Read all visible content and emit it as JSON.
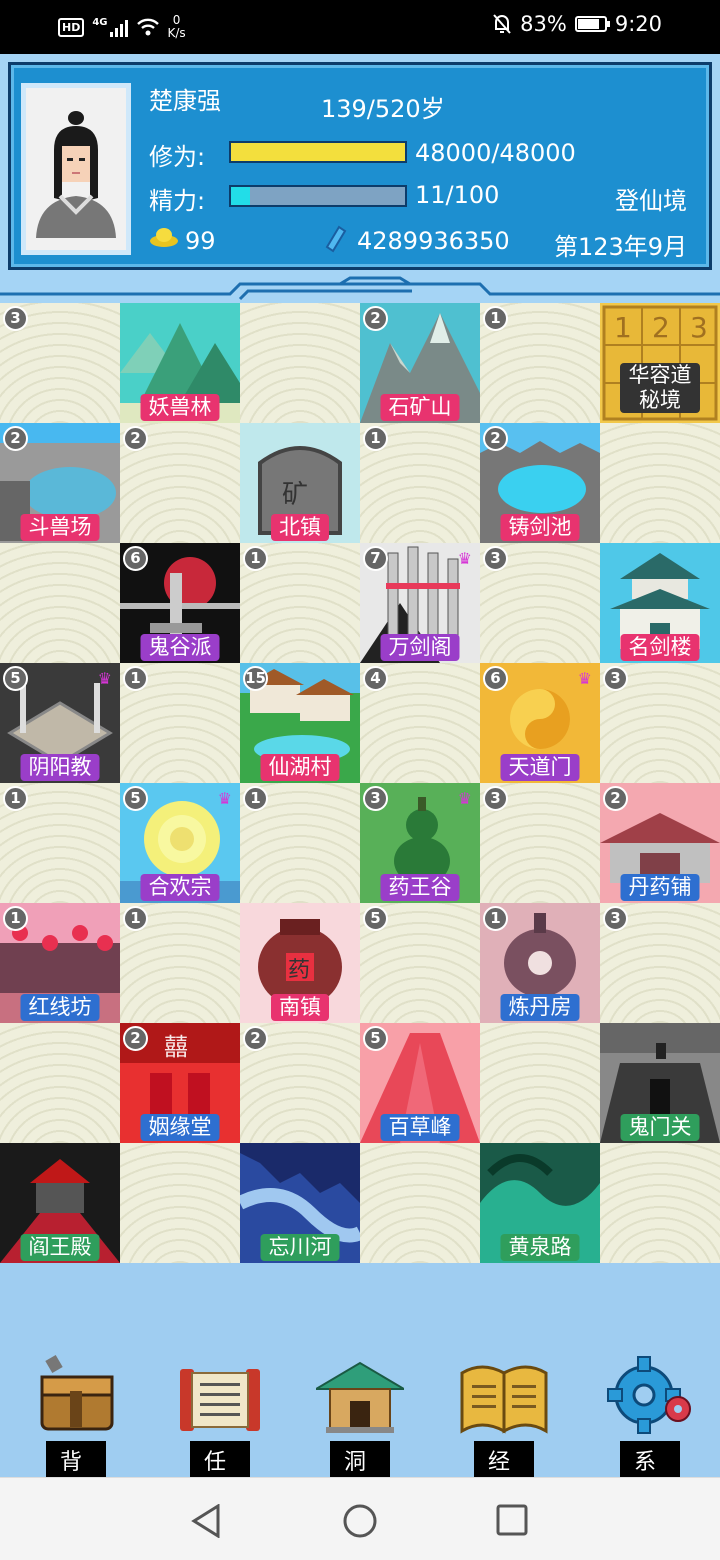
{
  "status": {
    "hd": "HD",
    "net": "4G",
    "speed_val": "0",
    "speed_unit": "K/s",
    "battery": "83%",
    "time": "9:20"
  },
  "player": {
    "name": "楚康强",
    "age": "139/520岁",
    "xiuwei_label": "修为:",
    "xiuwei": "48000/48000",
    "xiuwei_ratio": 1.0,
    "jingli_label": "精力:",
    "jingli": "11/100",
    "jingli_ratio": 0.11,
    "realm": "登仙境",
    "gold": "99",
    "crystal": "4289936350",
    "date": "第123年9月"
  },
  "colors": {
    "tile_bg": "#efefdc",
    "label_pink": "#e8336f",
    "label_purple": "#9a3ec9",
    "label_blue": "#2e6fd0",
    "label_green": "#2f9e5c"
  },
  "tiles": [
    {
      "badge": "3"
    },
    {
      "name": "妖兽林",
      "art": "forest",
      "lc": "pink"
    },
    {},
    {
      "badge": "2",
      "name": "石矿山",
      "art": "mountain",
      "lc": "pink"
    },
    {
      "badge": "1"
    },
    {
      "name": "华容道秘境",
      "art": "puzzle",
      "lc": "dark"
    },
    {
      "badge": "2",
      "name": "斗兽场",
      "art": "arena",
      "lc": "pink"
    },
    {
      "badge": "2"
    },
    {
      "name": "北镇",
      "art": "stone",
      "lc": "pink"
    },
    {
      "badge": "1"
    },
    {
      "badge": "2",
      "name": "铸剑池",
      "art": "pool",
      "lc": "pink"
    },
    {},
    {},
    {
      "badge": "6",
      "name": "鬼谷派",
      "art": "guigu",
      "lc": "purple"
    },
    {
      "badge": "1"
    },
    {
      "badge": "7",
      "name": "万剑阁",
      "art": "swords",
      "lc": "purple",
      "crown": true
    },
    {
      "badge": "3"
    },
    {
      "name": "名剑楼",
      "art": "pagoda",
      "lc": "pink"
    },
    {
      "badge": "5",
      "name": "阴阳教",
      "art": "altar",
      "lc": "purple",
      "crown": true
    },
    {
      "badge": "1"
    },
    {
      "badge": "15",
      "name": "仙湖村",
      "art": "village",
      "lc": "pink"
    },
    {
      "badge": "4"
    },
    {
      "badge": "6",
      "name": "天道门",
      "art": "taiji",
      "lc": "purple",
      "crown": true
    },
    {
      "badge": "3"
    },
    {
      "badge": "1"
    },
    {
      "badge": "5",
      "name": "合欢宗",
      "art": "flower",
      "lc": "purple",
      "crown": true
    },
    {
      "badge": "1"
    },
    {
      "badge": "3",
      "name": "药王谷",
      "art": "gourd",
      "lc": "purple",
      "crown": true
    },
    {
      "badge": "3"
    },
    {
      "badge": "2",
      "name": "丹药铺",
      "art": "shop",
      "lc": "blue"
    },
    {
      "badge": "1",
      "name": "红线坊",
      "art": "lantern",
      "lc": "blue"
    },
    {
      "badge": "1"
    },
    {
      "name": "南镇",
      "art": "jar",
      "lc": "pink"
    },
    {
      "badge": "5"
    },
    {
      "badge": "1",
      "name": "炼丹房",
      "art": "cauldron",
      "lc": "blue"
    },
    {
      "badge": "3"
    },
    {},
    {
      "badge": "2",
      "name": "姻缘堂",
      "art": "wedding",
      "lc": "blue"
    },
    {
      "badge": "2"
    },
    {
      "badge": "5",
      "name": "百草峰",
      "art": "redmount",
      "lc": "blue"
    },
    {},
    {
      "name": "鬼门关",
      "art": "gate",
      "lc": "green"
    },
    {
      "name": "阎王殿",
      "art": "hall",
      "lc": "green"
    },
    {},
    {
      "name": "忘川河",
      "art": "river",
      "lc": "green"
    },
    {},
    {
      "name": "黄泉路",
      "art": "spring",
      "lc": "green"
    },
    {}
  ],
  "nav": [
    {
      "label": "背包",
      "icon": "bag-icon"
    },
    {
      "label": "任务",
      "icon": "scroll-icon"
    },
    {
      "label": "洞府",
      "icon": "cave-house-icon"
    },
    {
      "label": "经历",
      "icon": "book-icon"
    },
    {
      "label": "系统",
      "icon": "gear-icon"
    }
  ]
}
